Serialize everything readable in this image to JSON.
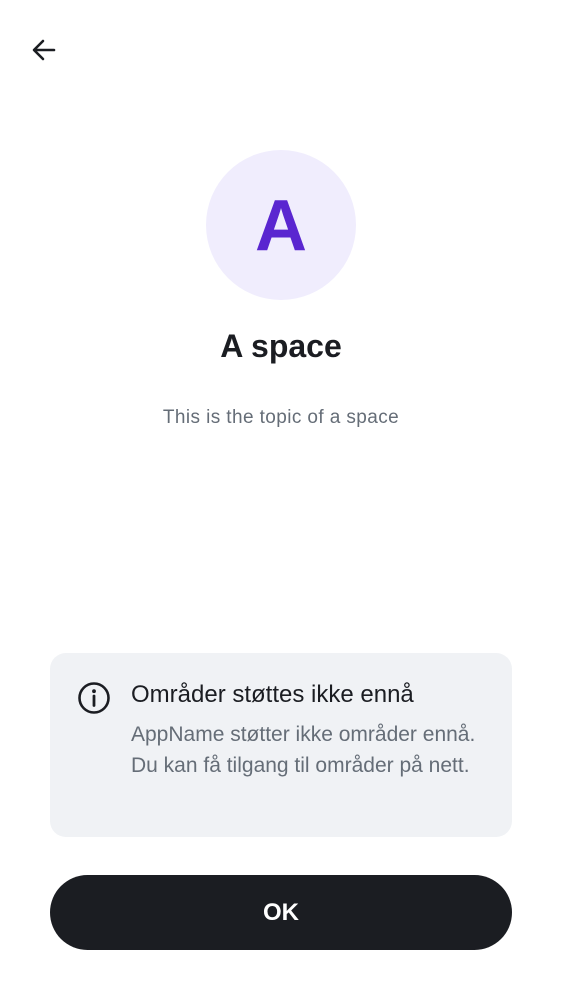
{
  "header": {
    "back_icon": "arrow-left-icon"
  },
  "space": {
    "avatar_letter": "A",
    "name": "A space",
    "topic": "This is the topic of a space"
  },
  "notice": {
    "icon": "info-icon",
    "title": "Områder støttes ikke ennå",
    "body": "AppName støtter ikke områder ennå. Du kan få tilgang til områder på nett."
  },
  "actions": {
    "ok_label": "OK"
  },
  "colors": {
    "avatar_bg": "#f0edfd",
    "avatar_letter": "#5a26d0",
    "primary_text": "#1b1d22",
    "secondary_text": "#656d77",
    "notice_bg": "#f0f2f5",
    "button_bg": "#1b1d22",
    "button_text": "#ffffff"
  }
}
